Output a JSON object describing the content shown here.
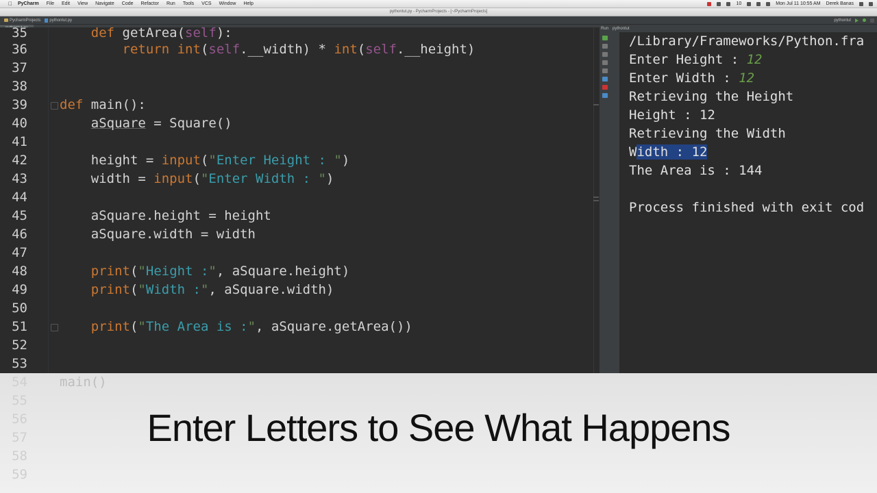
{
  "menubar": {
    "items": [
      "PyCharm",
      "File",
      "Edit",
      "View",
      "Navigate",
      "Code",
      "Refactor",
      "Run",
      "Tools",
      "VCS",
      "Window",
      "Help"
    ],
    "battery": "10",
    "clock": "Mon Jul 11  10:55 AM",
    "user": "Derek Banas"
  },
  "window": {
    "title": "pythontut.py - PycharmProjects - [~/PycharmProjects]"
  },
  "navbar": {
    "project": "PycharmProjects",
    "file": "pythontut.py",
    "run_config": "pythontut"
  },
  "editor": {
    "tab": "pythontut.py",
    "lines": [
      {
        "n": "35",
        "code": "    def getArea(self):"
      },
      {
        "n": "36",
        "code": "        return int(self.__width) * int(self.__height)"
      },
      {
        "n": "37",
        "code": ""
      },
      {
        "n": "38",
        "code": ""
      },
      {
        "n": "39",
        "code": "def main():"
      },
      {
        "n": "40",
        "code": "    aSquare = Square()"
      },
      {
        "n": "41",
        "code": ""
      },
      {
        "n": "42",
        "code": "    height = input(\"Enter Height : \")"
      },
      {
        "n": "43",
        "code": "    width = input(\"Enter Width : \")"
      },
      {
        "n": "44",
        "code": ""
      },
      {
        "n": "45",
        "code": "    aSquare.height = height"
      },
      {
        "n": "46",
        "code": "    aSquare.width = width"
      },
      {
        "n": "47",
        "code": ""
      },
      {
        "n": "48",
        "code": "    print(\"Height :\", aSquare.height)"
      },
      {
        "n": "49",
        "code": "    print(\"Width :\", aSquare.width)"
      },
      {
        "n": "50",
        "code": ""
      },
      {
        "n": "51",
        "code": "    print(\"The Area is :\", aSquare.getArea())"
      },
      {
        "n": "52",
        "code": ""
      },
      {
        "n": "53",
        "code": ""
      }
    ]
  },
  "run": {
    "tab": "Run",
    "config": "pythontut",
    "output": [
      {
        "text": "/Library/Frameworks/Python.fra"
      },
      {
        "label": "Enter Height : ",
        "input": "12"
      },
      {
        "label": "Enter Width : ",
        "input": "12"
      },
      {
        "text": "Retrieving the Height"
      },
      {
        "text": "Height : 12"
      },
      {
        "text": "Retrieving the Width"
      },
      {
        "pre": "W",
        "selected": "idth : 12"
      },
      {
        "text": "The Area is : 144"
      },
      {
        "text": ""
      },
      {
        "text": "Process finished with exit cod"
      }
    ]
  },
  "caption": {
    "text": "Enter Letters to See What Happens",
    "ghost_lines": [
      {
        "n": "54",
        "code": "main()"
      },
      {
        "n": "55",
        "code": ""
      },
      {
        "n": "56",
        "code": ""
      },
      {
        "n": "57",
        "code": ""
      },
      {
        "n": "58",
        "code": ""
      },
      {
        "n": "59",
        "code": ""
      }
    ]
  }
}
